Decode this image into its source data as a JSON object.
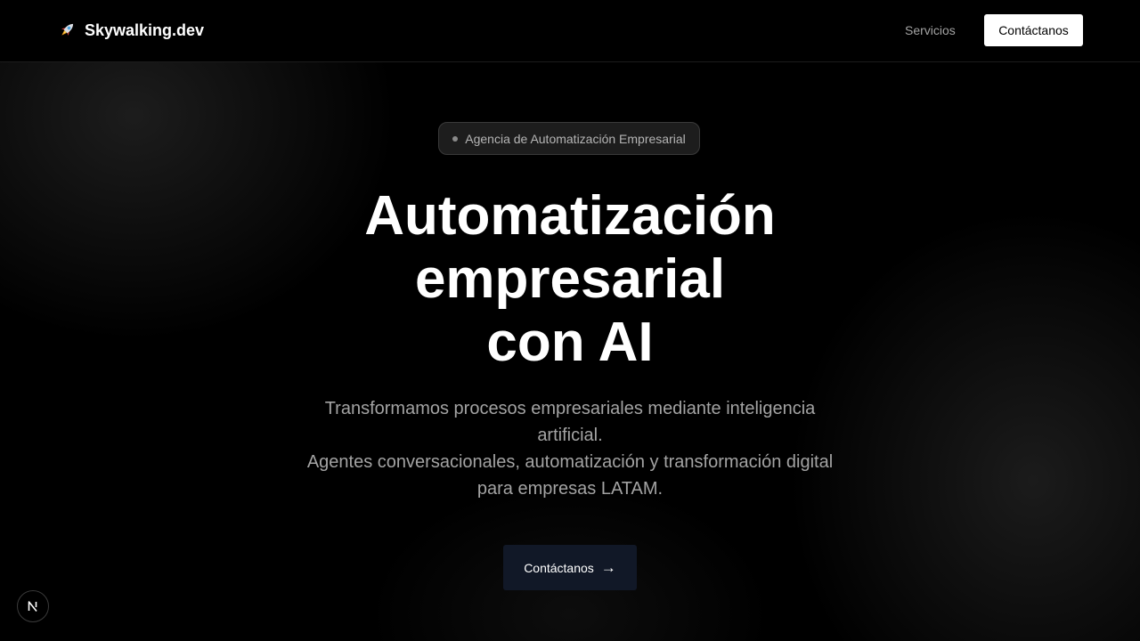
{
  "header": {
    "brand_icon": "rocket-icon",
    "brand_name": "Skywalking.dev",
    "nav_services": "Servicios",
    "nav_contact": "Contáctanos"
  },
  "hero": {
    "badge": "Agencia de Automatización Empresarial",
    "title_lines": [
      "Automatización",
      "empresarial",
      "con AI"
    ],
    "subtitle_lines": [
      "Transformamos procesos empresariales mediante inteligencia",
      "artificial.",
      "Agentes conversacionales, automatización y transformación digital",
      "para empresas LATAM."
    ],
    "cta_label": "Contáctanos",
    "cta_icon": "→"
  },
  "dev_indicator": {
    "icon": "nextjs-icon",
    "label": "N"
  },
  "colors": {
    "background": "#000000",
    "cta_background": "#111827",
    "muted_text": "#a3a3a3"
  }
}
